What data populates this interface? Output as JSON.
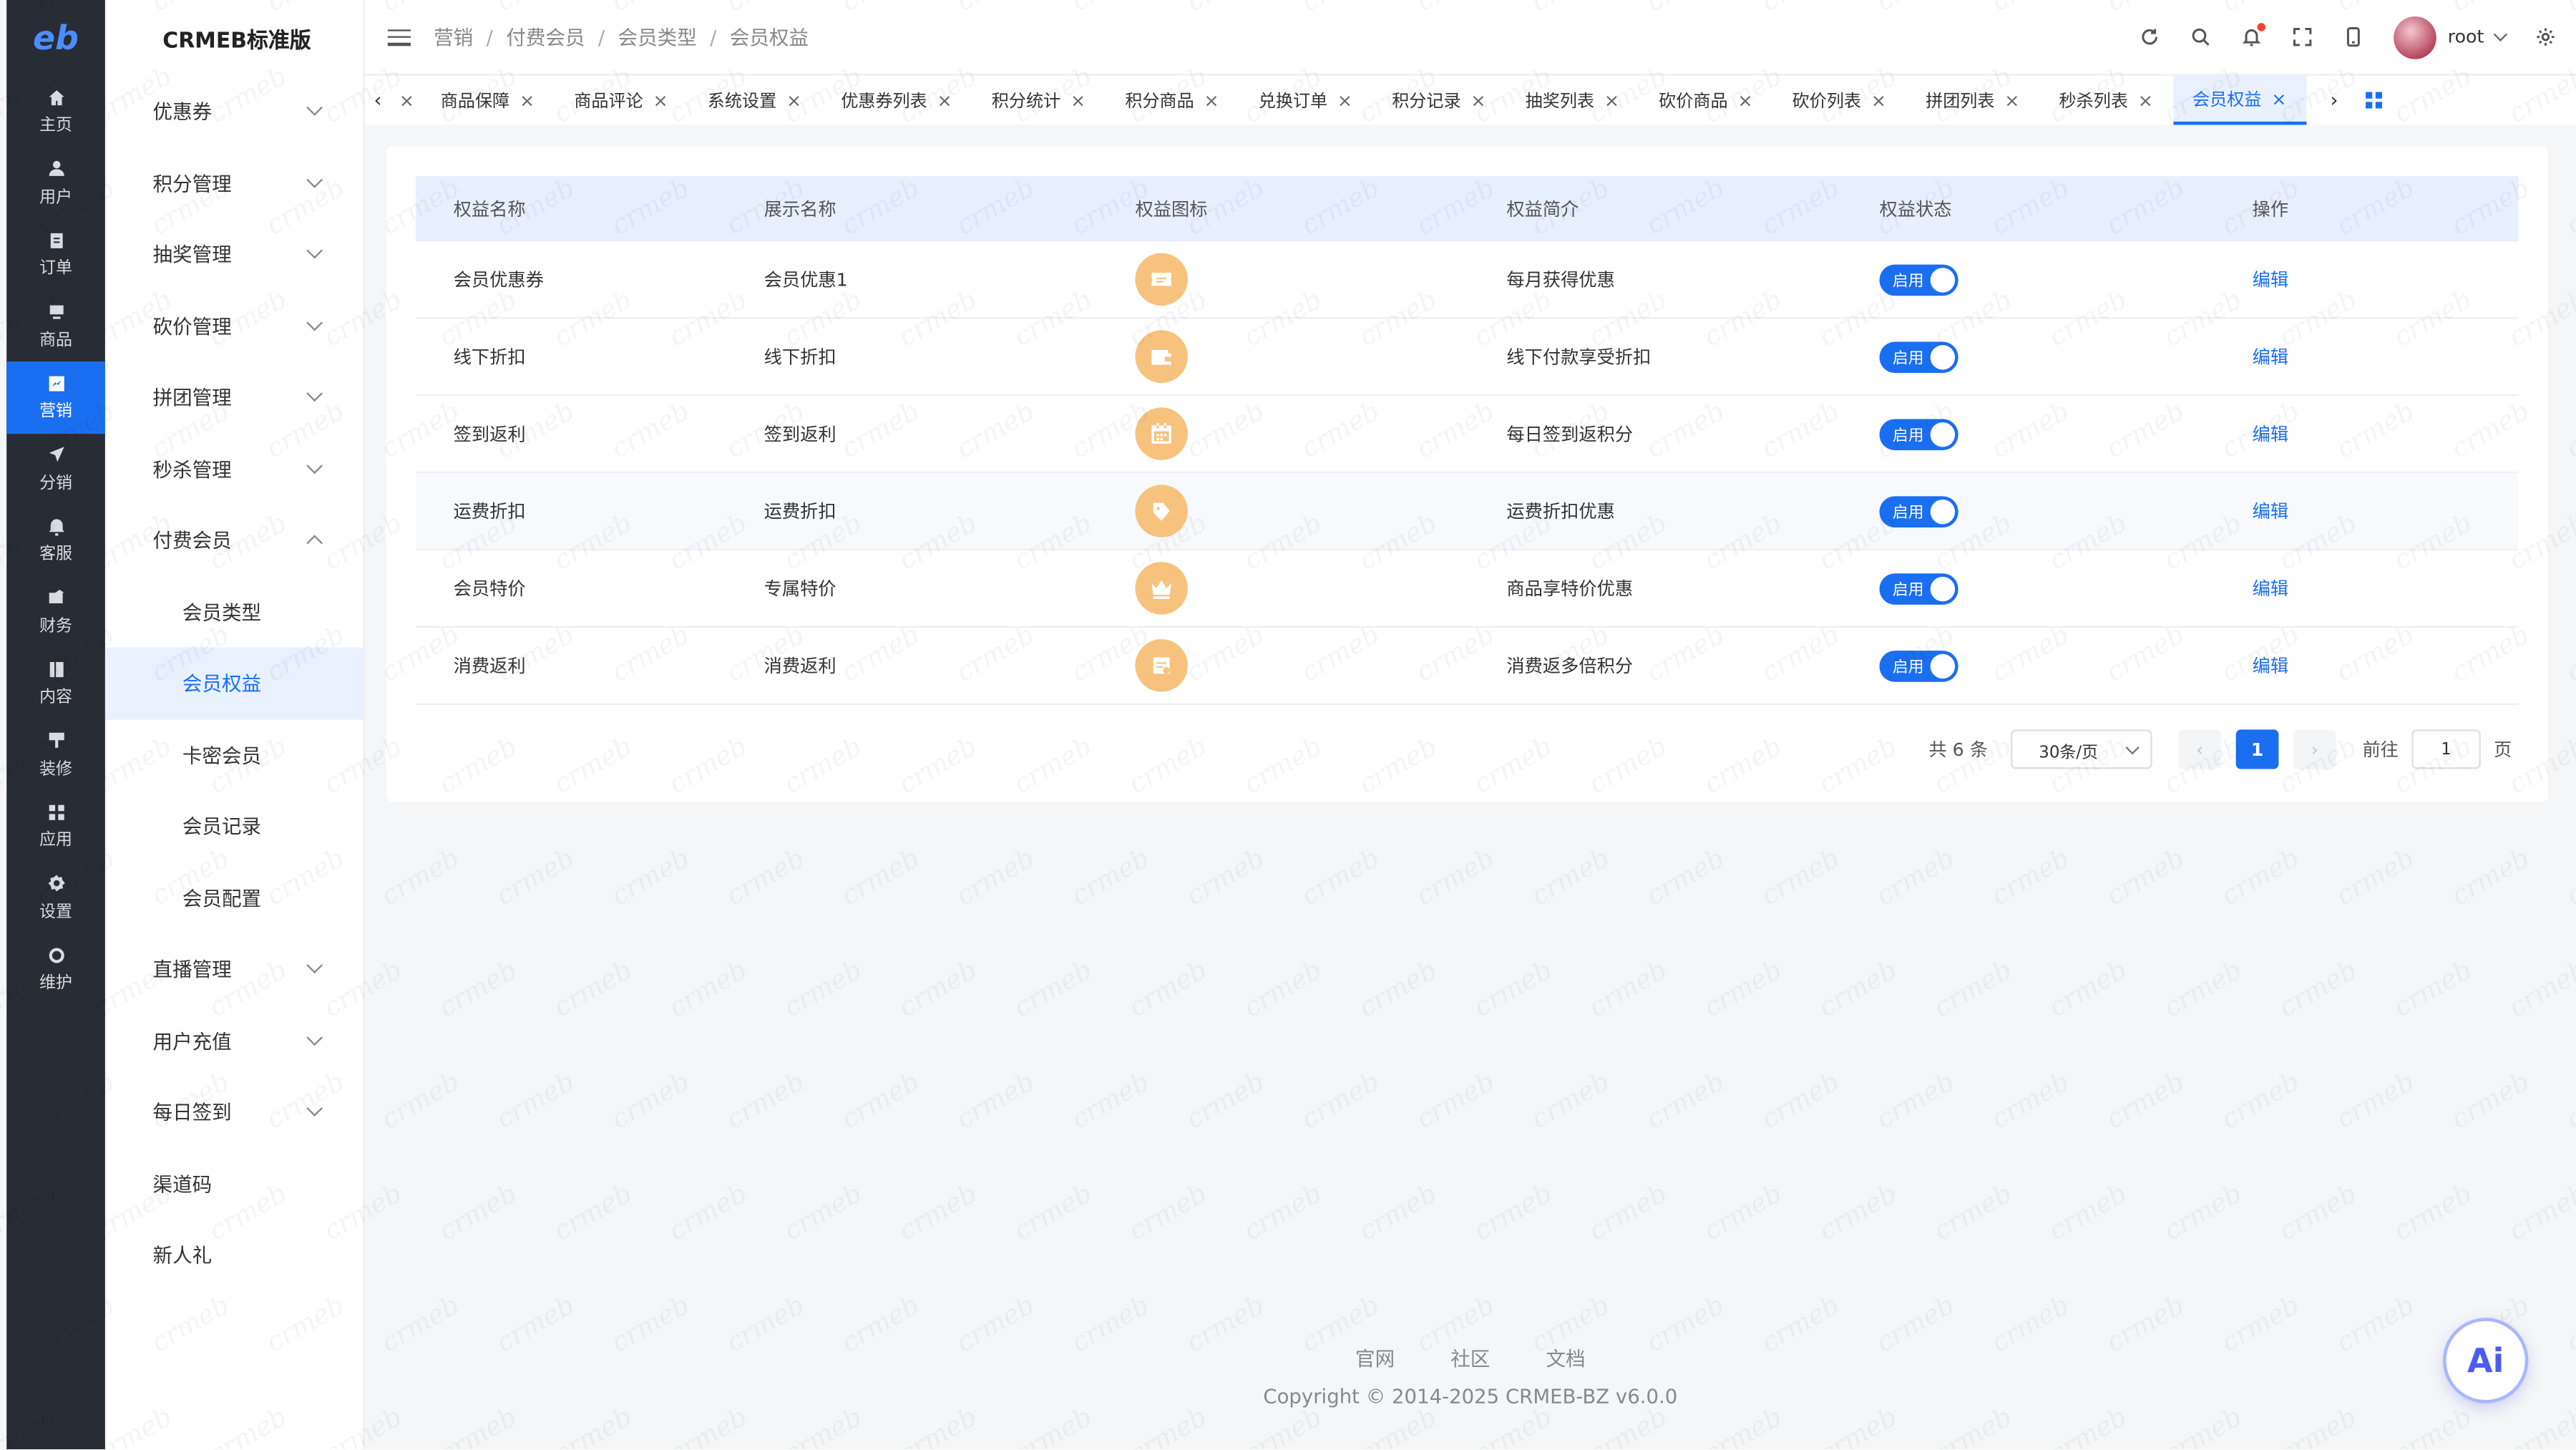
{
  "app": {
    "logo_text": "eb",
    "brand": "CRMEB标准版"
  },
  "rail": [
    {
      "label": "主页",
      "icon": "home-icon"
    },
    {
      "label": "用户",
      "icon": "user-icon"
    },
    {
      "label": "订单",
      "icon": "order-icon"
    },
    {
      "label": "商品",
      "icon": "product-icon"
    },
    {
      "label": "营销",
      "icon": "marketing-icon",
      "active": true
    },
    {
      "label": "分销",
      "icon": "distribution-icon"
    },
    {
      "label": "客服",
      "icon": "service-icon"
    },
    {
      "label": "财务",
      "icon": "finance-icon"
    },
    {
      "label": "内容",
      "icon": "content-icon"
    },
    {
      "label": "装修",
      "icon": "decorate-icon"
    },
    {
      "label": "应用",
      "icon": "apps-icon"
    },
    {
      "label": "设置",
      "icon": "settings-icon"
    },
    {
      "label": "维护",
      "icon": "maintain-icon"
    }
  ],
  "submenu": [
    {
      "label": "优惠券",
      "expandable": true
    },
    {
      "label": "积分管理",
      "expandable": true
    },
    {
      "label": "抽奖管理",
      "expandable": true
    },
    {
      "label": "砍价管理",
      "expandable": true
    },
    {
      "label": "拼团管理",
      "expandable": true
    },
    {
      "label": "秒杀管理",
      "expandable": true
    },
    {
      "label": "付费会员",
      "expandable": true,
      "expanded": true
    },
    {
      "label": "会员类型",
      "child": true
    },
    {
      "label": "会员权益",
      "child": true,
      "active": true
    },
    {
      "label": "卡密会员",
      "child": true
    },
    {
      "label": "会员记录",
      "child": true
    },
    {
      "label": "会员配置",
      "child": true
    },
    {
      "label": "直播管理",
      "expandable": true
    },
    {
      "label": "用户充值",
      "expandable": true
    },
    {
      "label": "每日签到",
      "expandable": true
    },
    {
      "label": "渠道码"
    },
    {
      "label": "新人礼"
    }
  ],
  "header": {
    "breadcrumb": [
      "营销",
      "付费会员",
      "会员类型",
      "会员权益"
    ],
    "user_name": "root"
  },
  "tabs": [
    {
      "label": "",
      "closable": true
    },
    {
      "label": "商品保障"
    },
    {
      "label": "商品评论"
    },
    {
      "label": "系统设置"
    },
    {
      "label": "优惠券列表"
    },
    {
      "label": "积分统计"
    },
    {
      "label": "积分商品"
    },
    {
      "label": "兑换订单"
    },
    {
      "label": "积分记录"
    },
    {
      "label": "抽奖列表"
    },
    {
      "label": "砍价商品"
    },
    {
      "label": "砍价列表"
    },
    {
      "label": "拼团列表"
    },
    {
      "label": "秒杀列表"
    },
    {
      "label": "会员权益",
      "active": true
    }
  ],
  "table": {
    "columns": [
      "权益名称",
      "展示名称",
      "权益图标",
      "权益简介",
      "权益状态",
      "操作"
    ],
    "rows": [
      {
        "name": "会员优惠券",
        "display": "会员优惠1",
        "icon": "coupon-icon",
        "desc": "每月获得优惠",
        "status": "启用",
        "action": "编辑"
      },
      {
        "name": "线下折扣",
        "display": "线下折扣",
        "icon": "wallet-icon",
        "desc": "线下付款享受折扣",
        "status": "启用",
        "action": "编辑"
      },
      {
        "name": "签到返利",
        "display": "签到返利",
        "icon": "calendar-icon",
        "desc": "每日签到返积分",
        "status": "启用",
        "action": "编辑"
      },
      {
        "name": "运费折扣",
        "display": "运费折扣",
        "icon": "truck-tag-icon",
        "desc": "运费折扣优惠",
        "status": "启用",
        "action": "编辑"
      },
      {
        "name": "会员特价",
        "display": "专属特价",
        "icon": "crown-icon",
        "desc": "商品享特价优惠",
        "status": "启用",
        "action": "编辑"
      },
      {
        "name": "消费返利",
        "display": "消费返利",
        "icon": "rebate-icon",
        "desc": "消费返多倍积分",
        "status": "启用",
        "action": "编辑"
      }
    ]
  },
  "pagination": {
    "total_text": "共 6 条",
    "page_size": "30条/页",
    "prev": "‹",
    "current_page": "1",
    "next": "›",
    "goto_label": "前往",
    "goto_value": "1",
    "page_suffix": "页"
  },
  "footer": {
    "links": [
      "官网",
      "社区",
      "文档"
    ],
    "copyright": "Copyright © 2014-2025 CRMEB-BZ v6.0.0"
  },
  "ai_button": "Ai",
  "watermark_text": "crmeb",
  "colors": {
    "primary": "#1a6ef0",
    "rail": "#282c34",
    "benefit_icon": "#f6c27d",
    "table_head": "#e8efff"
  }
}
